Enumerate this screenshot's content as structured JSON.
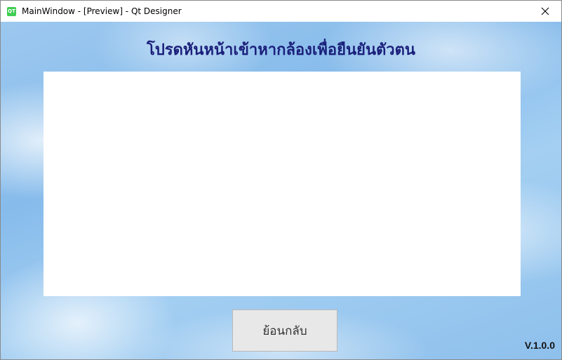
{
  "window": {
    "title": "MainWindow - [Preview] - Qt Designer",
    "app_icon_label": "QT"
  },
  "main": {
    "heading": "โปรดหันหน้าเข้าหากล้องเพื่อยืนยันตัวตน",
    "back_button_label": "ย้อนกลับ",
    "version": "V.1.0.0"
  },
  "icons": {
    "app": "qt-designer-icon",
    "close": "close-icon"
  },
  "colors": {
    "heading": "#1a1f7a",
    "background": "#8ec0ec",
    "qt_green": "#41cd52"
  }
}
